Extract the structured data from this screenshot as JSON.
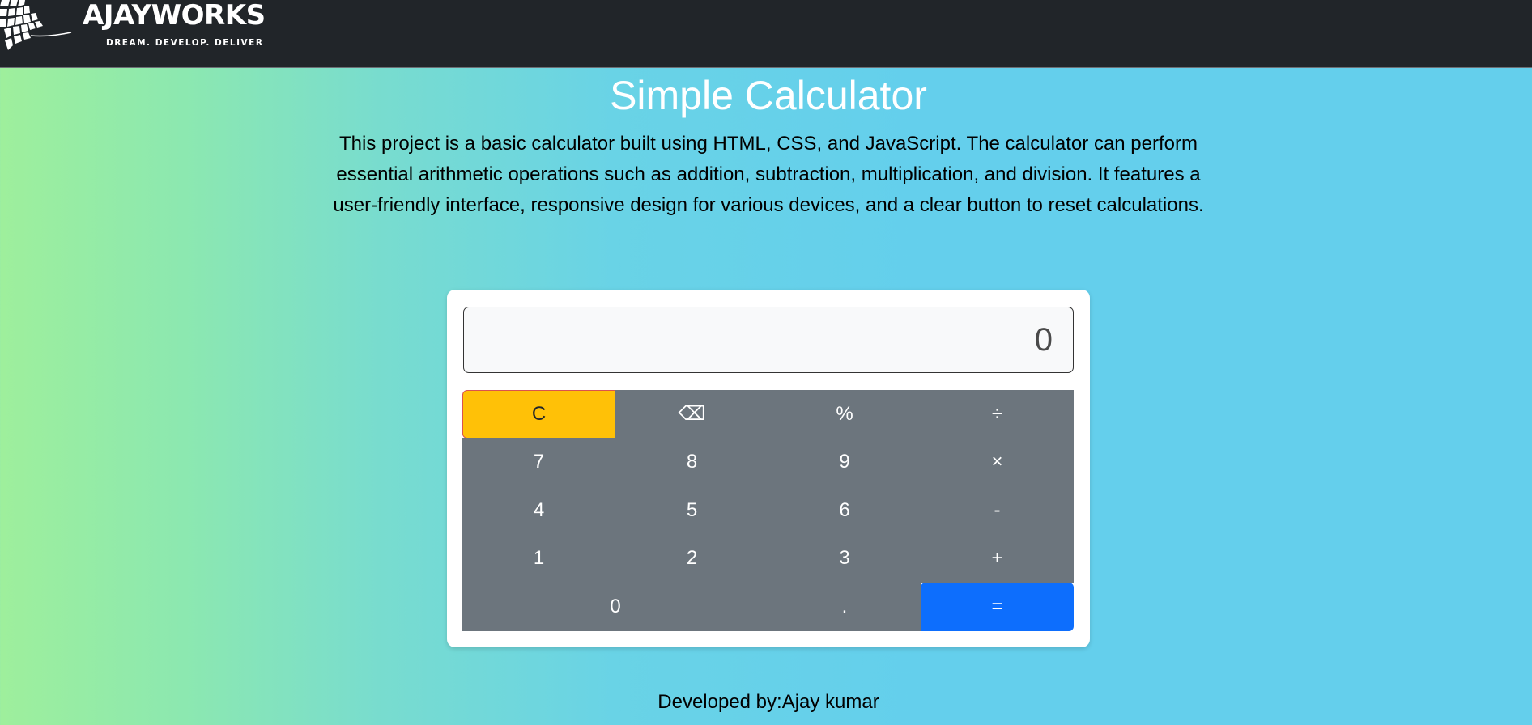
{
  "header": {
    "brand_name": "AJAYWORKS",
    "tagline": "DREAM. DEVELOP. DELIVER",
    "logo_icon": "ajayworks-logo-icon"
  },
  "main": {
    "title": "Simple Calculator",
    "description": "This project is a basic calculator built using HTML, CSS, and JavaScript. The calculator can perform essential arithmetic operations such as addition, subtraction, multiplication, and division. It features a user-friendly interface, responsive design for various devices, and a clear button to reset calculations."
  },
  "calculator": {
    "display_value": "0",
    "keys": {
      "clear": "C",
      "backspace": "⌫",
      "percent": "%",
      "divide": "÷",
      "seven": "7",
      "eight": "8",
      "nine": "9",
      "multiply": "×",
      "four": "4",
      "five": "5",
      "six": "6",
      "subtract": "-",
      "one": "1",
      "two": "2",
      "three": "3",
      "add": "+",
      "zero": "0",
      "decimal": ".",
      "equals": "="
    }
  },
  "footer": {
    "credit": "Developed by:Ajay kumar"
  },
  "colors": {
    "navbar": "#212529",
    "key_gray": "#6c757d",
    "clear_yellow": "#ffc107",
    "equals_blue": "#0d6efd",
    "gradient_start": "#9eef9c",
    "gradient_end": "#64cfec"
  }
}
